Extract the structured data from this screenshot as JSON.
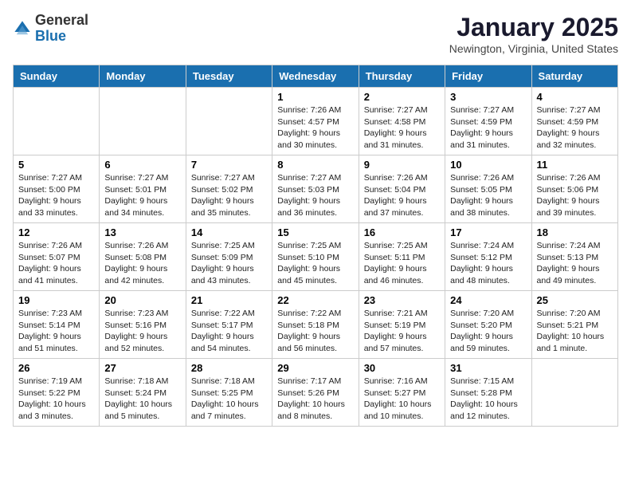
{
  "header": {
    "logo_general": "General",
    "logo_blue": "Blue",
    "month": "January 2025",
    "location": "Newington, Virginia, United States"
  },
  "weekdays": [
    "Sunday",
    "Monday",
    "Tuesday",
    "Wednesday",
    "Thursday",
    "Friday",
    "Saturday"
  ],
  "weeks": [
    [
      {
        "day": "",
        "info": ""
      },
      {
        "day": "",
        "info": ""
      },
      {
        "day": "",
        "info": ""
      },
      {
        "day": "1",
        "info": "Sunrise: 7:26 AM\nSunset: 4:57 PM\nDaylight: 9 hours\nand 30 minutes."
      },
      {
        "day": "2",
        "info": "Sunrise: 7:27 AM\nSunset: 4:58 PM\nDaylight: 9 hours\nand 31 minutes."
      },
      {
        "day": "3",
        "info": "Sunrise: 7:27 AM\nSunset: 4:59 PM\nDaylight: 9 hours\nand 31 minutes."
      },
      {
        "day": "4",
        "info": "Sunrise: 7:27 AM\nSunset: 4:59 PM\nDaylight: 9 hours\nand 32 minutes."
      }
    ],
    [
      {
        "day": "5",
        "info": "Sunrise: 7:27 AM\nSunset: 5:00 PM\nDaylight: 9 hours\nand 33 minutes."
      },
      {
        "day": "6",
        "info": "Sunrise: 7:27 AM\nSunset: 5:01 PM\nDaylight: 9 hours\nand 34 minutes."
      },
      {
        "day": "7",
        "info": "Sunrise: 7:27 AM\nSunset: 5:02 PM\nDaylight: 9 hours\nand 35 minutes."
      },
      {
        "day": "8",
        "info": "Sunrise: 7:27 AM\nSunset: 5:03 PM\nDaylight: 9 hours\nand 36 minutes."
      },
      {
        "day": "9",
        "info": "Sunrise: 7:26 AM\nSunset: 5:04 PM\nDaylight: 9 hours\nand 37 minutes."
      },
      {
        "day": "10",
        "info": "Sunrise: 7:26 AM\nSunset: 5:05 PM\nDaylight: 9 hours\nand 38 minutes."
      },
      {
        "day": "11",
        "info": "Sunrise: 7:26 AM\nSunset: 5:06 PM\nDaylight: 9 hours\nand 39 minutes."
      }
    ],
    [
      {
        "day": "12",
        "info": "Sunrise: 7:26 AM\nSunset: 5:07 PM\nDaylight: 9 hours\nand 41 minutes."
      },
      {
        "day": "13",
        "info": "Sunrise: 7:26 AM\nSunset: 5:08 PM\nDaylight: 9 hours\nand 42 minutes."
      },
      {
        "day": "14",
        "info": "Sunrise: 7:25 AM\nSunset: 5:09 PM\nDaylight: 9 hours\nand 43 minutes."
      },
      {
        "day": "15",
        "info": "Sunrise: 7:25 AM\nSunset: 5:10 PM\nDaylight: 9 hours\nand 45 minutes."
      },
      {
        "day": "16",
        "info": "Sunrise: 7:25 AM\nSunset: 5:11 PM\nDaylight: 9 hours\nand 46 minutes."
      },
      {
        "day": "17",
        "info": "Sunrise: 7:24 AM\nSunset: 5:12 PM\nDaylight: 9 hours\nand 48 minutes."
      },
      {
        "day": "18",
        "info": "Sunrise: 7:24 AM\nSunset: 5:13 PM\nDaylight: 9 hours\nand 49 minutes."
      }
    ],
    [
      {
        "day": "19",
        "info": "Sunrise: 7:23 AM\nSunset: 5:14 PM\nDaylight: 9 hours\nand 51 minutes."
      },
      {
        "day": "20",
        "info": "Sunrise: 7:23 AM\nSunset: 5:16 PM\nDaylight: 9 hours\nand 52 minutes."
      },
      {
        "day": "21",
        "info": "Sunrise: 7:22 AM\nSunset: 5:17 PM\nDaylight: 9 hours\nand 54 minutes."
      },
      {
        "day": "22",
        "info": "Sunrise: 7:22 AM\nSunset: 5:18 PM\nDaylight: 9 hours\nand 56 minutes."
      },
      {
        "day": "23",
        "info": "Sunrise: 7:21 AM\nSunset: 5:19 PM\nDaylight: 9 hours\nand 57 minutes."
      },
      {
        "day": "24",
        "info": "Sunrise: 7:20 AM\nSunset: 5:20 PM\nDaylight: 9 hours\nand 59 minutes."
      },
      {
        "day": "25",
        "info": "Sunrise: 7:20 AM\nSunset: 5:21 PM\nDaylight: 10 hours\nand 1 minute."
      }
    ],
    [
      {
        "day": "26",
        "info": "Sunrise: 7:19 AM\nSunset: 5:22 PM\nDaylight: 10 hours\nand 3 minutes."
      },
      {
        "day": "27",
        "info": "Sunrise: 7:18 AM\nSunset: 5:24 PM\nDaylight: 10 hours\nand 5 minutes."
      },
      {
        "day": "28",
        "info": "Sunrise: 7:18 AM\nSunset: 5:25 PM\nDaylight: 10 hours\nand 7 minutes."
      },
      {
        "day": "29",
        "info": "Sunrise: 7:17 AM\nSunset: 5:26 PM\nDaylight: 10 hours\nand 8 minutes."
      },
      {
        "day": "30",
        "info": "Sunrise: 7:16 AM\nSunset: 5:27 PM\nDaylight: 10 hours\nand 10 minutes."
      },
      {
        "day": "31",
        "info": "Sunrise: 7:15 AM\nSunset: 5:28 PM\nDaylight: 10 hours\nand 12 minutes."
      },
      {
        "day": "",
        "info": ""
      }
    ]
  ]
}
